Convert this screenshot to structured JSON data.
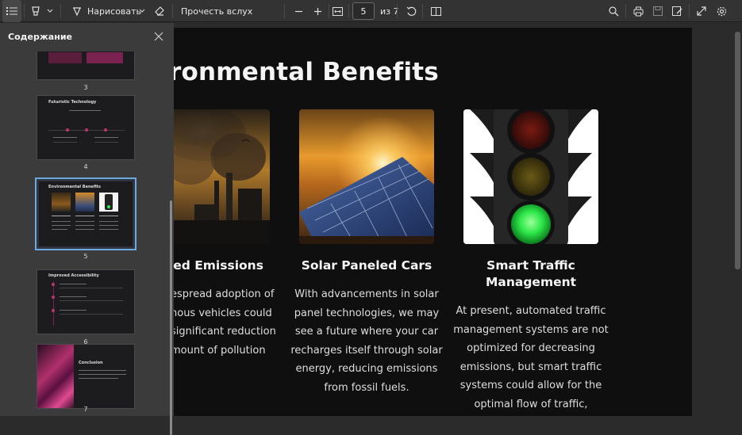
{
  "toolbar": {
    "draw_label": "Нарисовать",
    "read_aloud_label": "Прочесть вслух",
    "page_current": "5",
    "page_of": "из 7"
  },
  "sidebar": {
    "title": "Содержание",
    "thumbnails": [
      {
        "number": "3",
        "title": ""
      },
      {
        "number": "4",
        "title": "Futuristic Technology"
      },
      {
        "number": "5",
        "title": "Environmental Benefits"
      },
      {
        "number": "6",
        "title": "Improved Accessibility"
      },
      {
        "number": "7",
        "title": "Conclusion"
      }
    ],
    "selected_page": "5"
  },
  "page": {
    "title": "ronmental Benefits",
    "cards": [
      {
        "title": "ced Emissions",
        "text": [
          "espread adoption of",
          "nous vehicles could",
          "significant reduction",
          "mount of pollution"
        ]
      },
      {
        "title": "Solar Paneled Cars",
        "text": [
          "With advancements in solar",
          "panel technologies, we may",
          "see a future where your car",
          "recharges itself through solar",
          "energy, reducing emissions",
          "from fossil fuels."
        ]
      },
      {
        "title_lines": [
          "Smart Traffic",
          "Management"
        ],
        "text": [
          "At present, automated traffic",
          "management systems are not",
          "optimized for decreasing",
          "emissions, but smart traffic",
          "systems could allow for the",
          "optimal flow of traffic,"
        ]
      }
    ]
  },
  "colors": {
    "accent_selection": "#6ea8dd",
    "slide_background": "#0f0f10",
    "traffic_green": "#2ee84a",
    "magenta_accent": "#c0336d"
  }
}
